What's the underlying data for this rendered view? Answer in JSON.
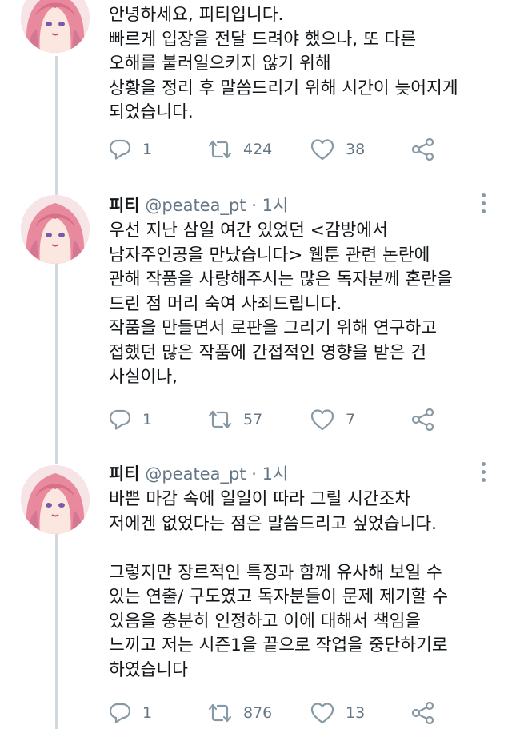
{
  "tweets": [
    {
      "text": "안녕하세요, 피티입니다.\n빠르게 입장을 전달 드려야 했으나, 또 다른\n오해를 불러일으키지 않기 위해\n상황을 정리 후 말씀드리기 위해 시간이 늦어지게\n되었습니다.",
      "replies": "1",
      "retweets": "424",
      "likes": "38"
    },
    {
      "name": "피티",
      "handle": "@peatea_pt",
      "separator": "·",
      "time": "1시",
      "text": "우선 지난 삼일 여간 있었던 <감방에서\n남자주인공을 만났습니다> 웹툰 관련 논란에\n관해 작품을 사랑해주시는 많은 독자분께 혼란을\n드린 점 머리 숙여 사죄드립니다.\n작품을 만들면서 로판을 그리기 위해 연구하고\n접했던 많은 작품에 간접적인 영향을 받은 건\n사실이나,",
      "replies": "1",
      "retweets": "57",
      "likes": "7"
    },
    {
      "name": "피티",
      "handle": "@peatea_pt",
      "separator": "·",
      "time": "1시",
      "text": "바쁜 마감 속에 일일이 따라 그릴 시간조차\n저에겐 없었다는 점은 말씀드리고 싶었습니다.\n\n그렇지만 장르적인 특징과 함께 유사해 보일 수\n있는 연출/ 구도였고 독자분들이 문제 제기할 수\n있음을 충분히 인정하고 이에 대해서 책임을\n느끼고 저는 시즌1을 끝으로 작업을 중단하기로\n하였습니다",
      "replies": "1",
      "retweets": "876",
      "likes": "13"
    }
  ],
  "colors": {
    "text": "#14171a",
    "muted": "#657786",
    "thread_line": "#cfd9de",
    "avatar_hair": "#e8899e"
  },
  "icons": [
    "avatar",
    "reply-icon",
    "retweet-icon",
    "like-icon",
    "share-icon",
    "more-icon"
  ]
}
